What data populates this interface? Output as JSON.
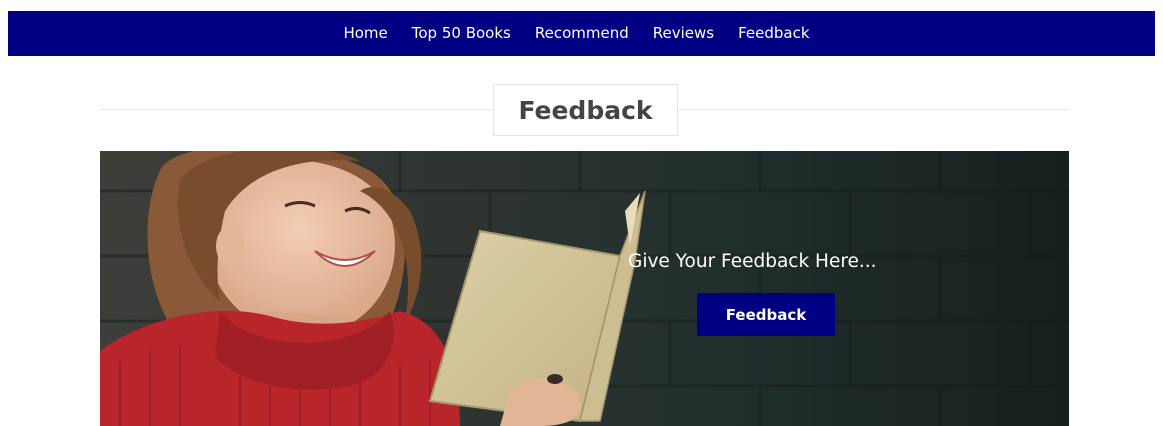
{
  "nav": {
    "items": [
      {
        "label": "Home"
      },
      {
        "label": "Top 50 Books"
      },
      {
        "label": "Recommend"
      },
      {
        "label": "Reviews"
      },
      {
        "label": "Feedback"
      }
    ]
  },
  "section": {
    "title": "Feedback"
  },
  "banner": {
    "caption": "Give Your Feedback Here...",
    "button_label": "Feedback"
  },
  "colors": {
    "nav_background": "#010083",
    "button_background": "#010083",
    "heading_text": "#444444"
  }
}
